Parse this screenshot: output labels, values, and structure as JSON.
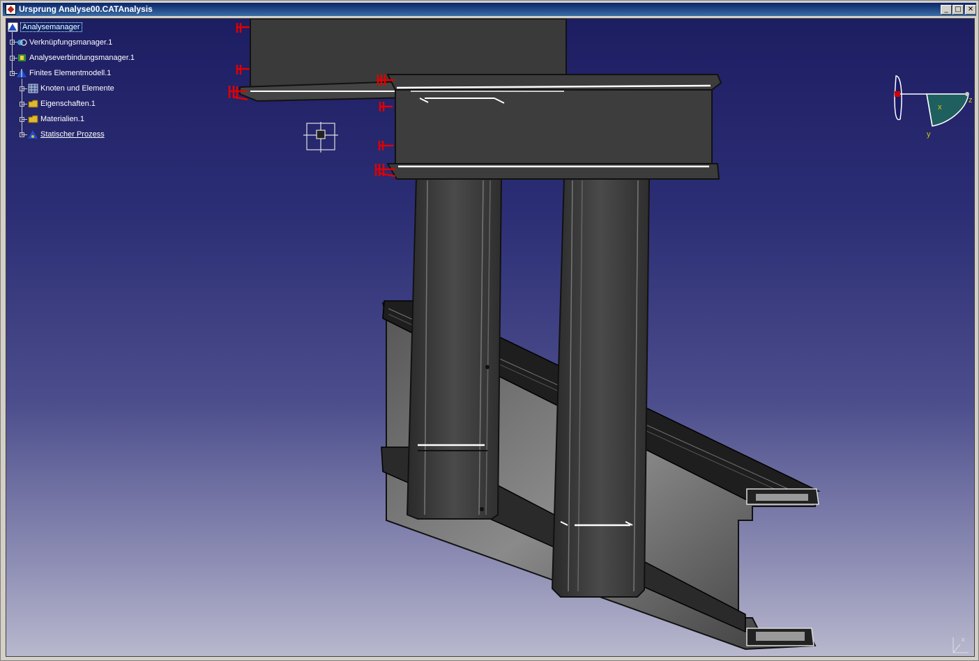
{
  "window": {
    "title": "Ursprung Analyse00.CATAnalysis",
    "buttons": {
      "minimize": "_",
      "maximize": "□",
      "close": "✕"
    }
  },
  "tree": {
    "items": [
      {
        "label": "Analysemanager",
        "icon": "analysis-manager-icon",
        "state": "selected"
      },
      {
        "label": "Verknüpfungsmanager.1",
        "icon": "link-manager-icon"
      },
      {
        "label": "Analyseverbindungsmanager.1",
        "icon": "analysis-connection-manager-icon"
      },
      {
        "label": "Finites Elementmodell.1",
        "icon": "finite-element-model-icon"
      },
      {
        "label": "Knoten und Elemente",
        "icon": "nodes-elements-icon"
      },
      {
        "label": "Eigenschaften.1",
        "icon": "properties-icon"
      },
      {
        "label": "Materialien.1",
        "icon": "materials-icon"
      },
      {
        "label": "Statischer Prozess",
        "icon": "static-process-icon",
        "state": "underlined"
      }
    ]
  },
  "compass": {
    "axes": [
      "x",
      "y",
      "z"
    ]
  },
  "colors": {
    "background_top": "#1d1d62",
    "background_bottom": "#b8b8ce",
    "part_fill": "#3c3c3c",
    "clamp_red": "#e00000",
    "selection_blue": "#0a246a"
  }
}
